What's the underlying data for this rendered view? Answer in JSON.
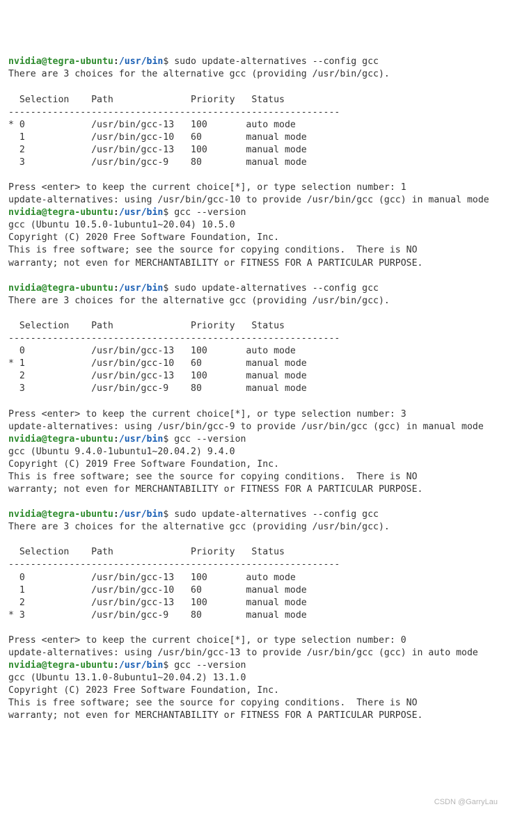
{
  "prompt": {
    "user": "nvidia@tegra-ubuntu",
    "sep1": ":",
    "path": "/usr/bin",
    "sep2": "$"
  },
  "cmd_config": " sudo update-alternatives --config gcc",
  "cmd_version": " gcc --version",
  "choices_line": "There are 3 choices for the alternative gcc (providing /usr/bin/gcc).",
  "header": "  Selection    Path              Priority   Status",
  "hr": "------------------------------------------------------------",
  "tables": {
    "t1": [
      "* 0            /usr/bin/gcc-13   100       auto mode",
      "  1            /usr/bin/gcc-10   60        manual mode",
      "  2            /usr/bin/gcc-13   100       manual mode",
      "  3            /usr/bin/gcc-9    80        manual mode"
    ],
    "t2": [
      "  0            /usr/bin/gcc-13   100       auto mode",
      "* 1            /usr/bin/gcc-10   60        manual mode",
      "  2            /usr/bin/gcc-13   100       manual mode",
      "  3            /usr/bin/gcc-9    80        manual mode"
    ],
    "t3": [
      "  0            /usr/bin/gcc-13   100       auto mode",
      "  1            /usr/bin/gcc-10   60        manual mode",
      "  2            /usr/bin/gcc-13   100       manual mode",
      "* 3            /usr/bin/gcc-9    80        manual mode"
    ]
  },
  "prompts_sel": {
    "p1": "Press <enter> to keep the current choice[*], or type selection number: 1",
    "p2": "Press <enter> to keep the current choice[*], or type selection number: 3",
    "p3": "Press <enter> to keep the current choice[*], or type selection number: 0"
  },
  "results": {
    "r1": "update-alternatives: using /usr/bin/gcc-10 to provide /usr/bin/gcc (gcc) in manual mode",
    "r2": "update-alternatives: using /usr/bin/gcc-9 to provide /usr/bin/gcc (gcc) in manual mode",
    "r3": "update-alternatives: using /usr/bin/gcc-13 to provide /usr/bin/gcc (gcc) in auto mode"
  },
  "versions": {
    "v1": [
      "gcc (Ubuntu 10.5.0-1ubuntu1~20.04) 10.5.0",
      "Copyright (C) 2020 Free Software Foundation, Inc.",
      "This is free software; see the source for copying conditions.  There is NO",
      "warranty; not even for MERCHANTABILITY or FITNESS FOR A PARTICULAR PURPOSE."
    ],
    "v2": [
      "gcc (Ubuntu 9.4.0-1ubuntu1~20.04.2) 9.4.0",
      "Copyright (C) 2019 Free Software Foundation, Inc.",
      "This is free software; see the source for copying conditions.  There is NO",
      "warranty; not even for MERCHANTABILITY or FITNESS FOR A PARTICULAR PURPOSE."
    ],
    "v3": [
      "gcc (Ubuntu 13.1.0-8ubuntu1~20.04.2) 13.1.0",
      "Copyright (C) 2023 Free Software Foundation, Inc.",
      "This is free software; see the source for copying conditions.  There is NO",
      "warranty; not even for MERCHANTABILITY or FITNESS FOR A PARTICULAR PURPOSE."
    ]
  },
  "watermark": "CSDN @GarryLau"
}
